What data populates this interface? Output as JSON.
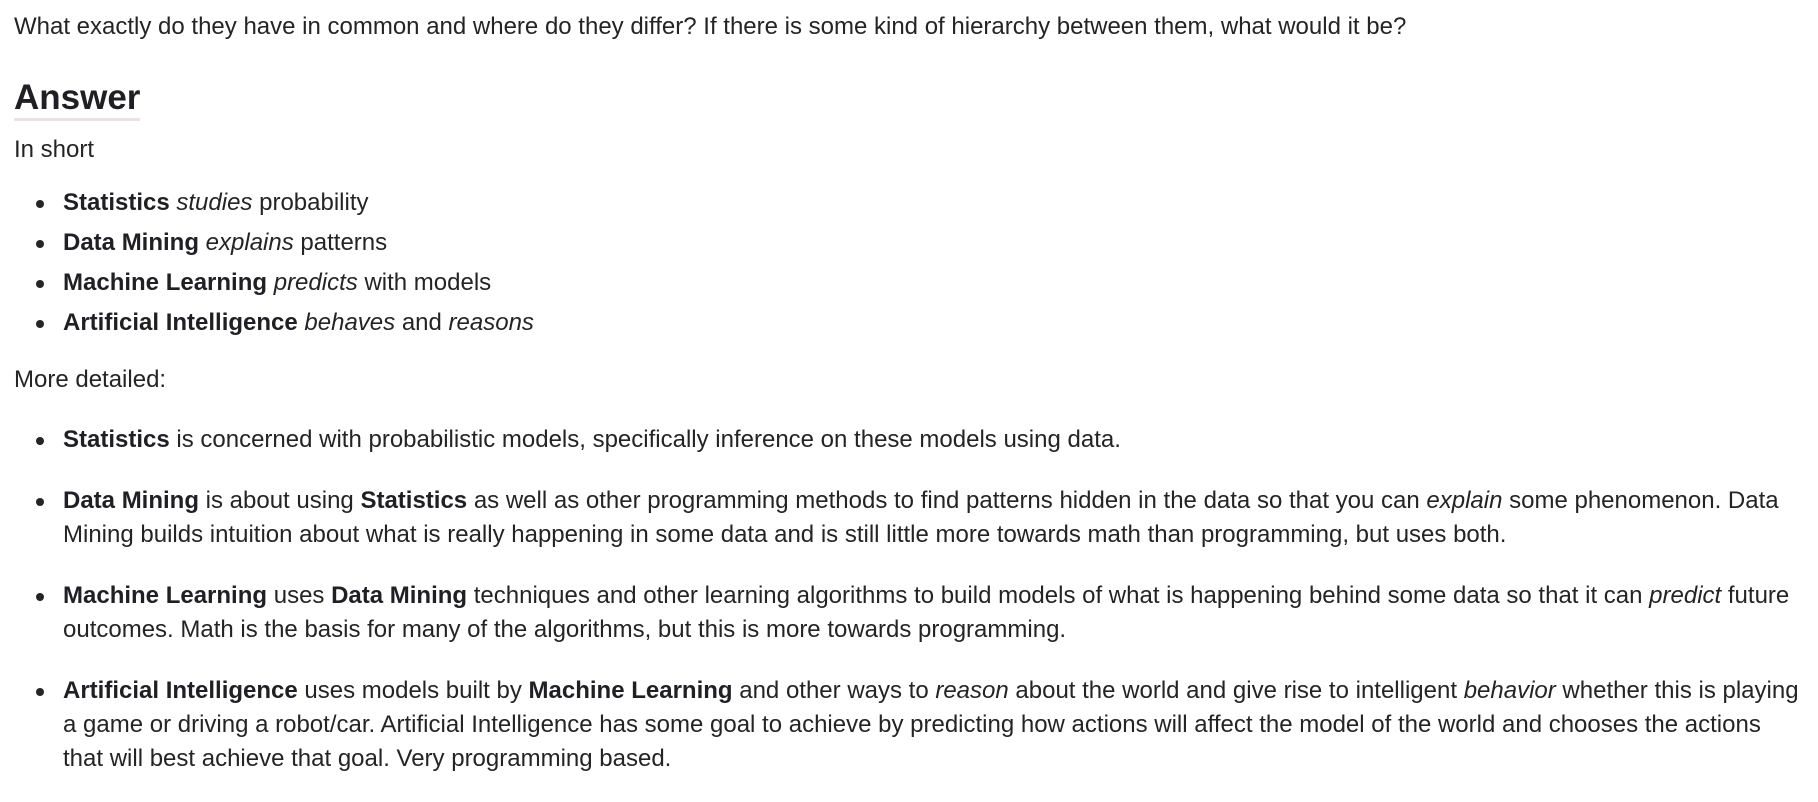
{
  "question": "What exactly do they have in common and where do they differ? If there is some kind of hierarchy between them, what would it be?",
  "answer_heading": "Answer",
  "in_short_label": "In short",
  "short_list": [
    {
      "term": "Statistics",
      "verb": "studies",
      "rest": "probability"
    },
    {
      "term": "Data Mining",
      "verb": "explains",
      "rest": "patterns"
    },
    {
      "term": "Machine Learning",
      "verb": "predicts",
      "rest": "with models"
    },
    {
      "term": "Artificial Intelligence",
      "verb": "behaves",
      "joiner": "and",
      "verb2": "reasons"
    }
  ],
  "more_detailed_label": "More detailed:",
  "detail_list": [
    {
      "term": "Statistics",
      "text1": " is concerned with probabilistic models, specifically inference on these models using data."
    },
    {
      "term": "Data Mining",
      "text1": " is about using ",
      "ref": "Statistics",
      "text2": " as well as other programming methods to find patterns hidden in the data so that you can ",
      "em": "explain",
      "text3": " some phenomenon. Data Mining builds intuition about what is really happening in some data and is still little more towards math than programming, but uses both."
    },
    {
      "term": "Machine Learning",
      "text1": " uses ",
      "ref": "Data Mining",
      "text2": " techniques and other learning algorithms to build models of what is happening behind some data so that it can ",
      "em": "predict",
      "text3": " future outcomes. Math is the basis for many of the algorithms, but this is more towards programming."
    },
    {
      "term": "Artificial Intelligence",
      "text1": " uses models built by ",
      "ref": "Machine Learning",
      "text2": " and other ways to ",
      "em": "reason",
      "text3": " about the world and give rise to intelligent ",
      "em2": "behavior",
      "text4": " whether this is playing a game or driving a robot/car. Artificial Intelligence has some goal to achieve by predicting how actions will affect the model of the world and chooses the actions that will best achieve that goal. Very programming based."
    }
  ]
}
